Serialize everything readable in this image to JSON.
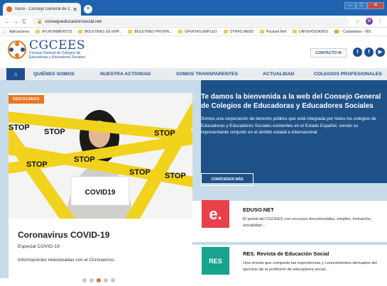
{
  "browser": {
    "tab_title": "Inicio - Consejo General de Cole",
    "url": "consejoeducacionsocial.net",
    "bookmarks": [
      "Aplicaciones",
      "AYUNTAMIENTOS",
      "BOLETINES DE EMP...",
      "BOLETINES PROVIN...",
      "OFERTAS EMPLEO",
      "OTRAS WEBS",
      "Packard Bell",
      "UNIVERSIDADES",
      "- Ciudadanos - 060"
    ]
  },
  "header": {
    "logo_text": "CGCEES",
    "logo_sub1": "Consejo General de Colegios de",
    "logo_sub2": "Educadoras y Educadores Sociales",
    "contact_label": "CONTACTO"
  },
  "nav": {
    "items": [
      "QUIÉNES SOMOS",
      "NUESTRA ACTIVIDAD",
      "SOMOS TRANSPARENTES",
      "ACTUALIDAD",
      "COLEGIOS PROFESIONALES"
    ]
  },
  "slider": {
    "badge": "DESTACADOS",
    "title": "Coronavirus COVID-19",
    "subtitle": "Especial COVID-19",
    "description": "Informaciones relacionadas con el Coronavirus.",
    "sign_text": "COVID19",
    "tape_text": "STOP",
    "dots": 5,
    "active_dot": 3
  },
  "welcome": {
    "title": "Te damos la bienvenida a la web del Consejo General de Colegios de Educadoras y Educadores Sociales",
    "text": "Somos una corporación de derecho público que está integrada por todos los colegios de Educadoras y Educadores Sociales existentes en el Estado Español, siendo su representante conjunto en el ámbito estatal e internacional",
    "cta": "CONÓCENOS MÁS"
  },
  "cards": [
    {
      "logo": "e.",
      "title": "EDUSO.NET",
      "desc": "El portal del CGCEES con recursos documentales, empleo, formación, actualidad...",
      "color": "#e8414b"
    },
    {
      "logo": "RES",
      "title": "RES. Revista de Educación Social",
      "desc": "Una revista que comparte las experiencias y conocimientos derivados del ejercicio de la profesión de educador/a social...",
      "color": "#17a38c"
    }
  ]
}
